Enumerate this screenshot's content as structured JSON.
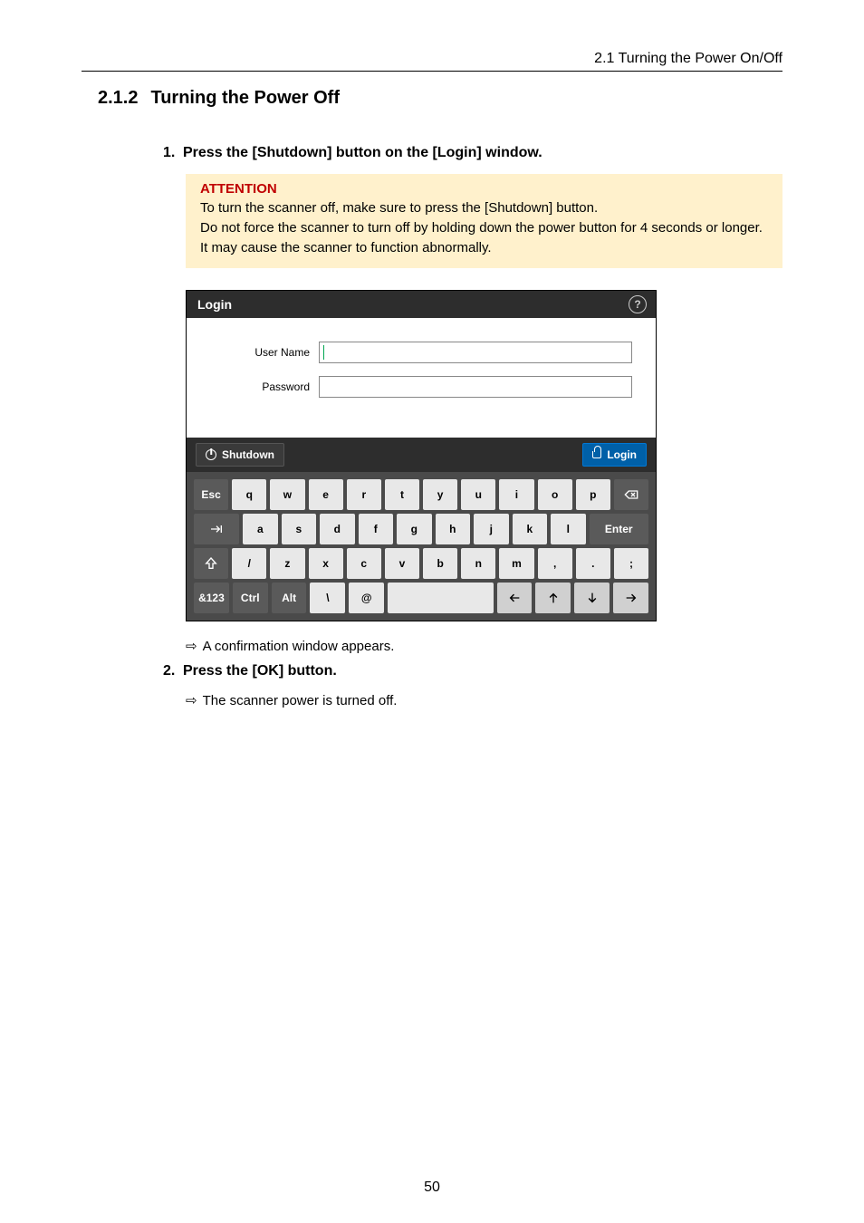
{
  "header": {
    "breadcrumb": "2.1 Turning the Power On/Off"
  },
  "section": {
    "number": "2.1.2",
    "title": "Turning the Power Off"
  },
  "steps": {
    "s1": {
      "num": "1.",
      "text": "Press the [Shutdown] button on the [Login] window."
    },
    "s2": {
      "num": "2.",
      "text": "Press the [OK] button."
    }
  },
  "attention": {
    "title": "ATTENTION",
    "line1": "To turn the scanner off, make sure to press the [Shutdown] button.",
    "line2": "Do not force the scanner to turn off by holding down the power button for 4 seconds or longer.",
    "line3": "It may cause the scanner to function abnormally."
  },
  "login": {
    "window_title": "Login",
    "username_label": "User Name",
    "password_label": "Password",
    "shutdown_label": "Shutdown",
    "login_label": "Login"
  },
  "keyboard": {
    "row1": {
      "esc": "Esc",
      "q": "q",
      "w": "w",
      "e": "e",
      "r": "r",
      "t": "t",
      "y": "y",
      "u": "u",
      "i": "i",
      "o": "o",
      "p": "p"
    },
    "row2": {
      "a": "a",
      "s": "s",
      "d": "d",
      "f": "f",
      "g": "g",
      "h": "h",
      "j": "j",
      "k": "k",
      "l": "l",
      "enter": "Enter"
    },
    "row3": {
      "slash": "/",
      "z": "z",
      "x": "x",
      "c": "c",
      "v": "v",
      "b": "b",
      "n": "n",
      "m": "m",
      "comma": ",",
      "period": ".",
      "semicolon": ";"
    },
    "row4": {
      "sym": "&123",
      "ctrl": "Ctrl",
      "alt": "Alt",
      "backslash": "\\",
      "at": "@"
    }
  },
  "results": {
    "r1": "A confirmation window appears.",
    "r2": "The scanner power is turned off."
  },
  "symbols": {
    "result_arrow": "⇨"
  },
  "page_number": "50"
}
